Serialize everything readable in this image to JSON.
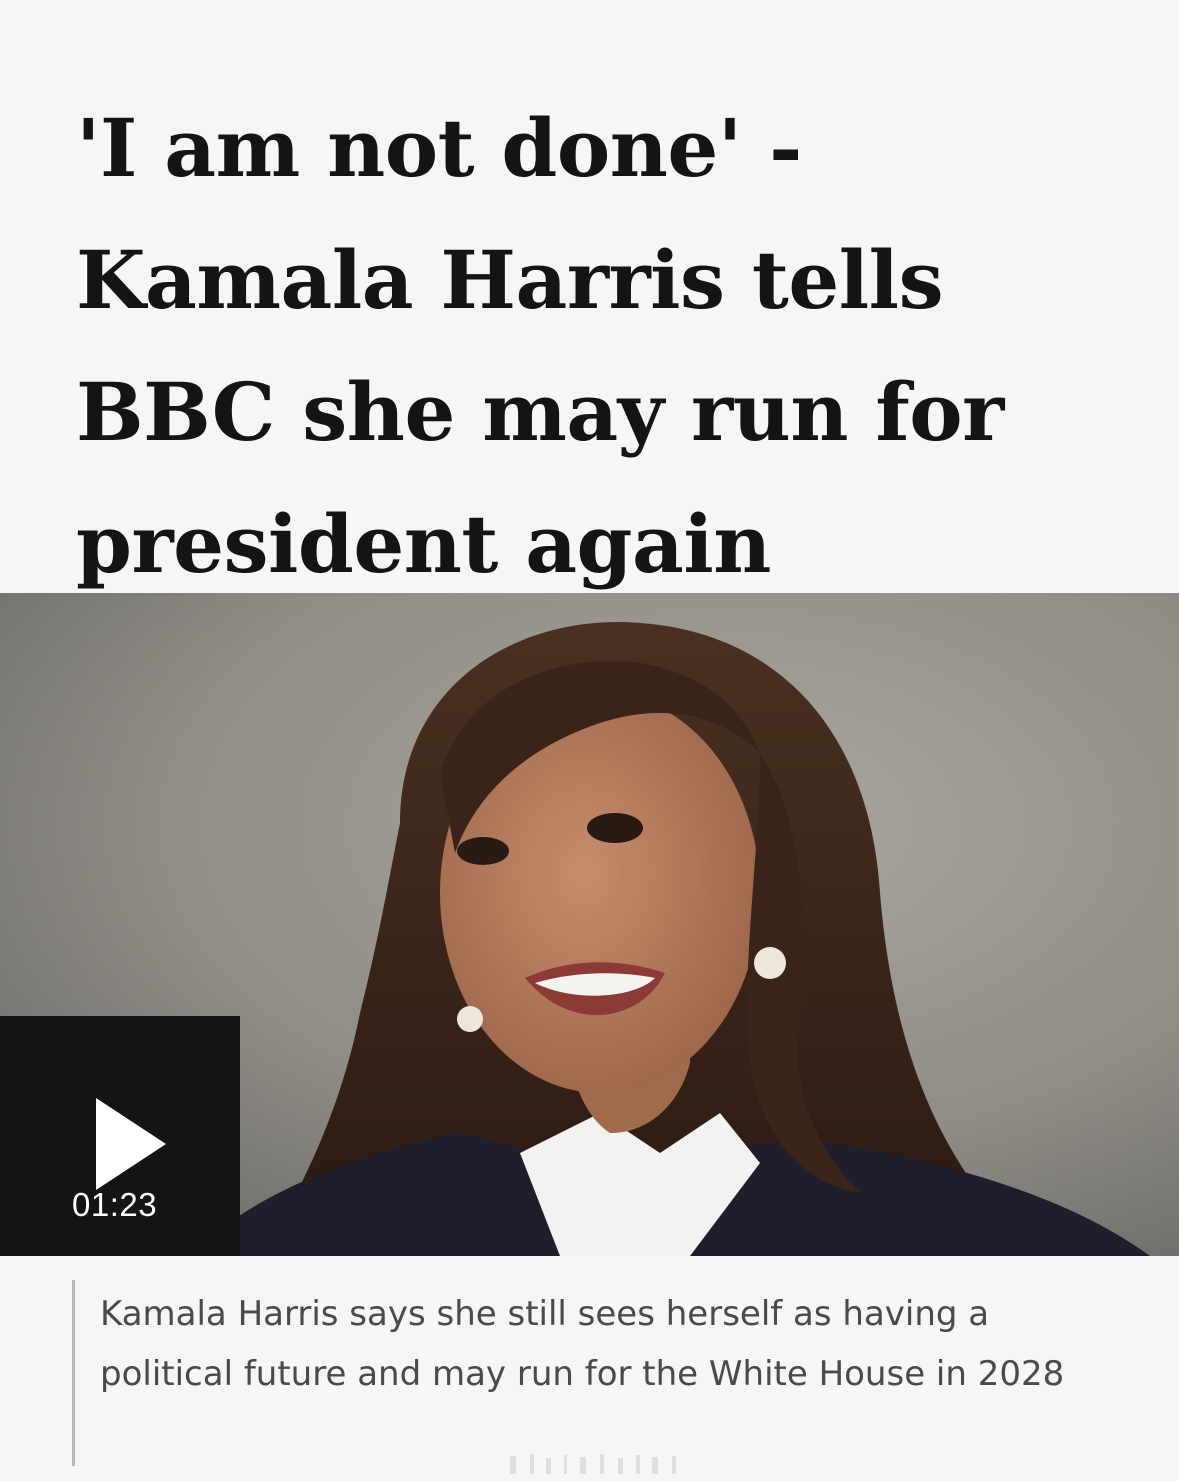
{
  "article": {
    "headline": "'I am not done' - Kamala Harris tells BBC she may run for president again",
    "caption": "Kamala Harris says she still sees herself as having a political future and may run for the White House in 2028"
  },
  "video": {
    "duration": "01:23",
    "play_icon": "play-icon"
  },
  "colors": {
    "background": "#f6f6f6",
    "headline_text": "#141414",
    "caption_text": "#4a4a4a",
    "player_overlay": "#141414"
  }
}
